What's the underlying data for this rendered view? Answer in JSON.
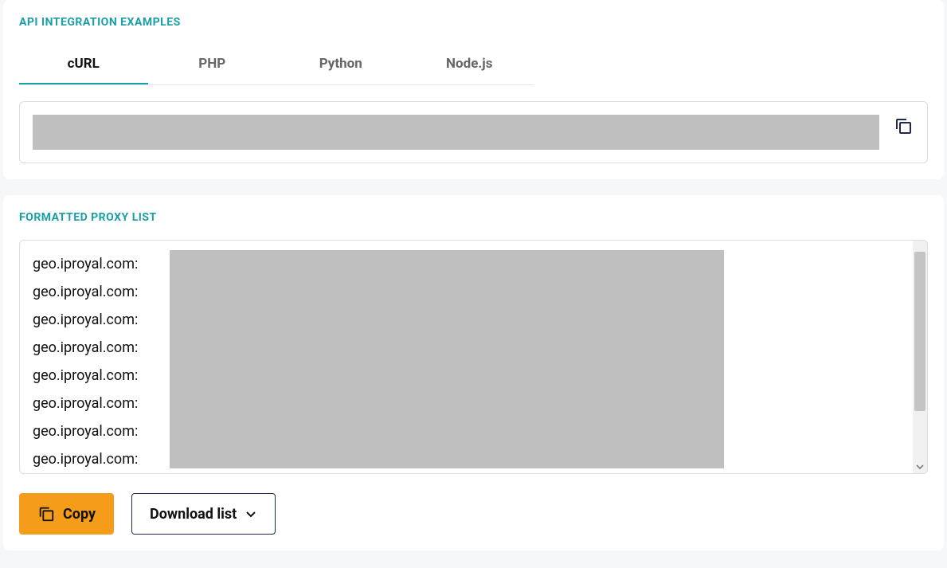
{
  "api_section": {
    "title": "API INTEGRATION EXAMPLES",
    "tabs": [
      {
        "label": "cURL",
        "active": true
      },
      {
        "label": "PHP",
        "active": false
      },
      {
        "label": "Python",
        "active": false
      },
      {
        "label": "Node.js",
        "active": false
      }
    ],
    "code_redacted": true
  },
  "proxy_section": {
    "title": "FORMATTED PROXY LIST",
    "visible_prefix": "geo.iproyal.com:",
    "lines": [
      "geo.iproyal.com:",
      "geo.iproyal.com:",
      "geo.iproyal.com:",
      "geo.iproyal.com:",
      "geo.iproyal.com:",
      "geo.iproyal.com:",
      "geo.iproyal.com:",
      "geo.iproyal.com:"
    ],
    "redacted_overlay": true
  },
  "actions": {
    "copy_label": "Copy",
    "download_label": "Download list"
  },
  "colors": {
    "accent_teal": "#1a9fa6",
    "button_orange": "#f59c1a",
    "outline_navy": "#1b2a4e",
    "redact_gray": "#bfbfbf"
  }
}
